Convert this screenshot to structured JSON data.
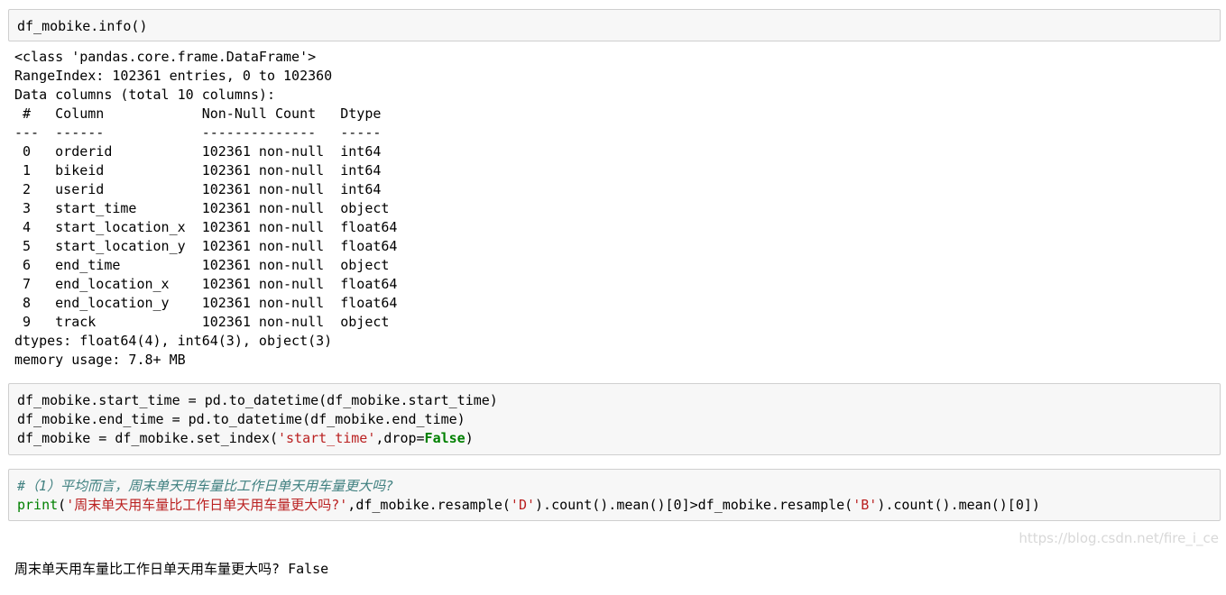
{
  "cells": [
    {
      "input": [
        "df_mobike.info()"
      ],
      "output": [
        "<class 'pandas.core.frame.DataFrame'>",
        "RangeIndex: 102361 entries, 0 to 102360",
        "Data columns (total 10 columns):",
        " #   Column            Non-Null Count   Dtype  ",
        "---  ------            --------------   -----  ",
        " 0   orderid           102361 non-null  int64  ",
        " 1   bikeid            102361 non-null  int64  ",
        " 2   userid            102361 non-null  int64  ",
        " 3   start_time        102361 non-null  object ",
        " 4   start_location_x  102361 non-null  float64",
        " 5   start_location_y  102361 non-null  float64",
        " 6   end_time          102361 non-null  object ",
        " 7   end_location_x    102361 non-null  float64",
        " 8   end_location_y    102361 non-null  float64",
        " 9   track             102361 non-null  object ",
        "dtypes: float64(4), int64(3), object(3)",
        "memory usage: 7.8+ MB"
      ]
    },
    {
      "input_line1": "df_mobike.start_time = pd.to_datetime(df_mobike.start_time)",
      "input_line2": "df_mobike.end_time = pd.to_datetime(df_mobike.end_time)",
      "input_line3": {
        "pre": "df_mobike = df_mobike.set_index(",
        "str": "'start_time'",
        "mid": ",drop=",
        "kw": "False",
        "post": ")"
      }
    },
    {
      "comment": "#（1）平均而言，周末单天用车量比工作日单天用车量更大吗?",
      "print_fn": "print",
      "p1": "(",
      "str1": "'周末单天用车量比工作日单天用车量更大吗?'",
      "p2": ",df_mobike.resample(",
      "str2": "'D'",
      "p3": ").count().mean()[0]>df_mobike.resample(",
      "str3": "'B'",
      "p4": ").count().mean()[0])",
      "output": "周末单天用车量比工作日单天用车量更大吗? False"
    }
  ],
  "watermark": "https://blog.csdn.net/fire_i_ce"
}
